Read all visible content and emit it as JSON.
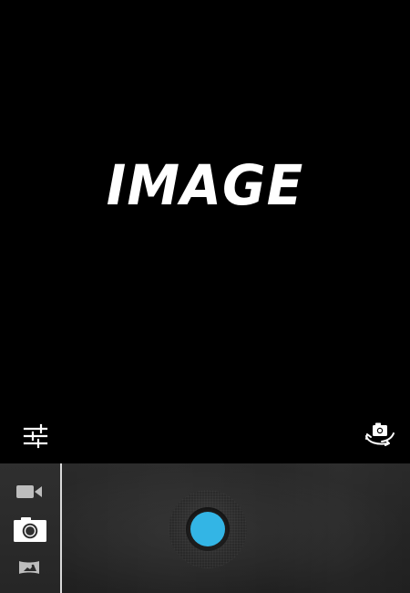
{
  "viewfinder": {
    "preview_text": "IMAGE"
  },
  "controls": {
    "top_left_icon": "sliders-icon",
    "top_right_icon": "switch-camera-icon"
  },
  "mode_selector": {
    "items": [
      {
        "name": "video",
        "icon": "video-camera-icon",
        "selected": false
      },
      {
        "name": "photo",
        "icon": "camera-icon",
        "selected": true
      },
      {
        "name": "panorama",
        "icon": "panorama-icon",
        "selected": false
      }
    ]
  },
  "shutter": {
    "accent_color": "#33b5e5"
  },
  "colors": {
    "background": "#000000",
    "bar": "#262626",
    "icon_primary": "#ffffff",
    "icon_secondary": "#d0d0d0",
    "divider": "#d9d9d9"
  }
}
